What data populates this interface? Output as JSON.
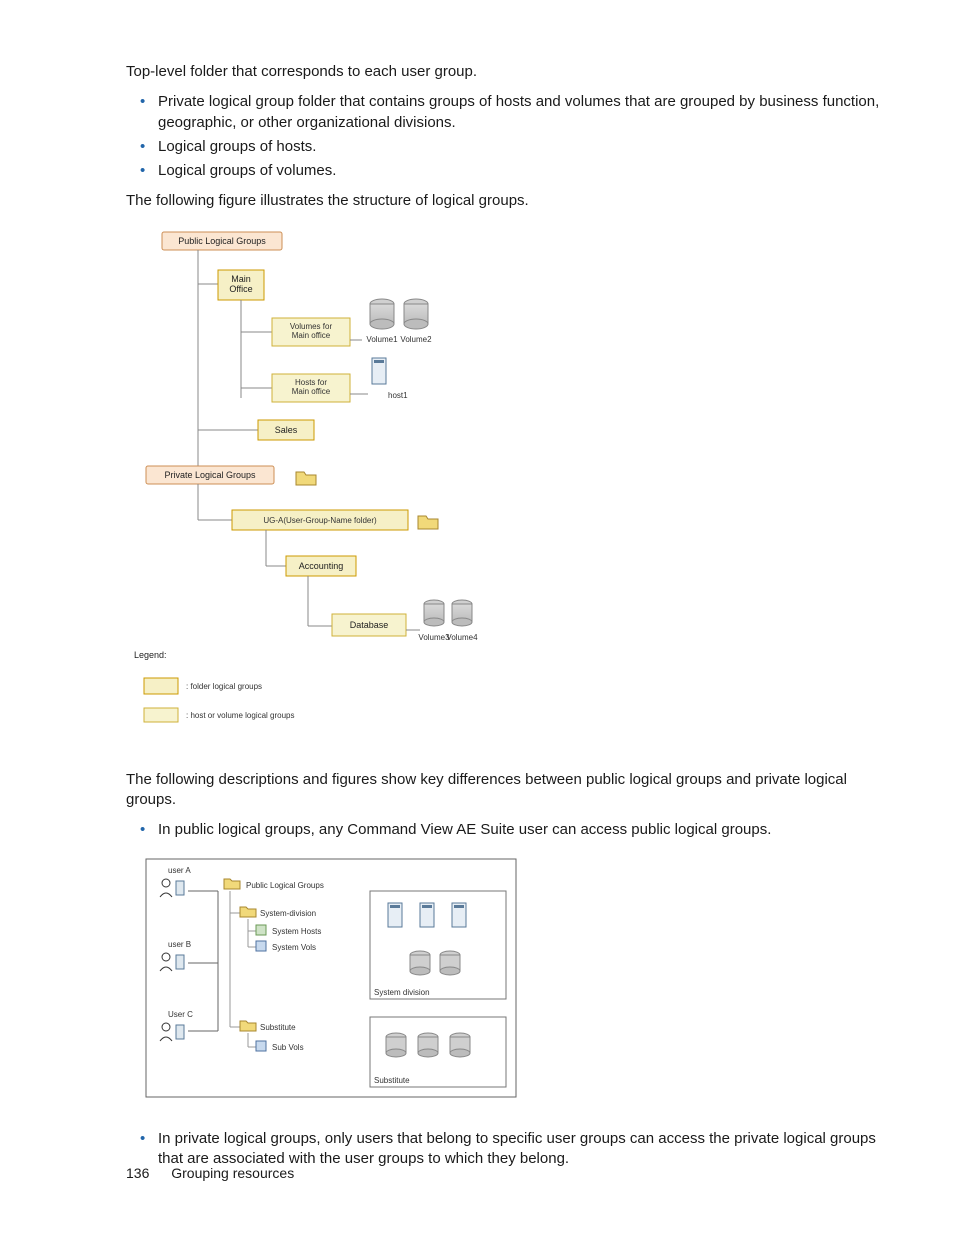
{
  "intro": "Top-level folder that corresponds to each user group.",
  "topBullets": [
    "Private logical group folder that contains groups of hosts and volumes that are grouped by business function, geographic, or other organizational divisions.",
    "Logical groups of hosts.",
    "Logical groups of volumes."
  ],
  "figLead": "The following figure illustrates the structure of logical groups.",
  "diagram1": {
    "publicLG": "Public Logical Groups",
    "mainOffice": "Main\nOffice",
    "volsMain": "Volumes for\nMain office",
    "vol1": "Volume1",
    "vol2": "Volume2",
    "hostsMain": "Hosts for\nMain office",
    "host1": "host1",
    "sales": "Sales",
    "privateLG": "Private Logical Groups",
    "ugFolder": "UG-A(User-Group-Name folder)",
    "accounting": "Accounting",
    "database": "Database",
    "vol3": "Volume3",
    "vol4": "Volume4",
    "legendTitle": "Legend:",
    "legendFolder": ": folder logical groups",
    "legendHV": ": host or volume logical groups"
  },
  "midPara": "The following descriptions and figures show key differences between public logical groups and private logical groups.",
  "midBullet": "In public logical groups, any Command View AE Suite user can access public logical groups.",
  "diagram2": {
    "userA": "user A",
    "userB": "user B",
    "userC": "User C",
    "publicLG": "Public Logical Groups",
    "sysDiv": "System-division",
    "sysHosts": "System Hosts",
    "sysVols": "System Vols",
    "substitute": "Substitute",
    "subVols": "Sub Vols",
    "boxSysDiv": "System division",
    "boxSub": "Substitute"
  },
  "lastBullet": "In private logical groups, only users that belong to specific user groups can access the private logical groups that are associated with the user groups to which they belong.",
  "footer": {
    "page": "136",
    "section": "Grouping resources"
  }
}
